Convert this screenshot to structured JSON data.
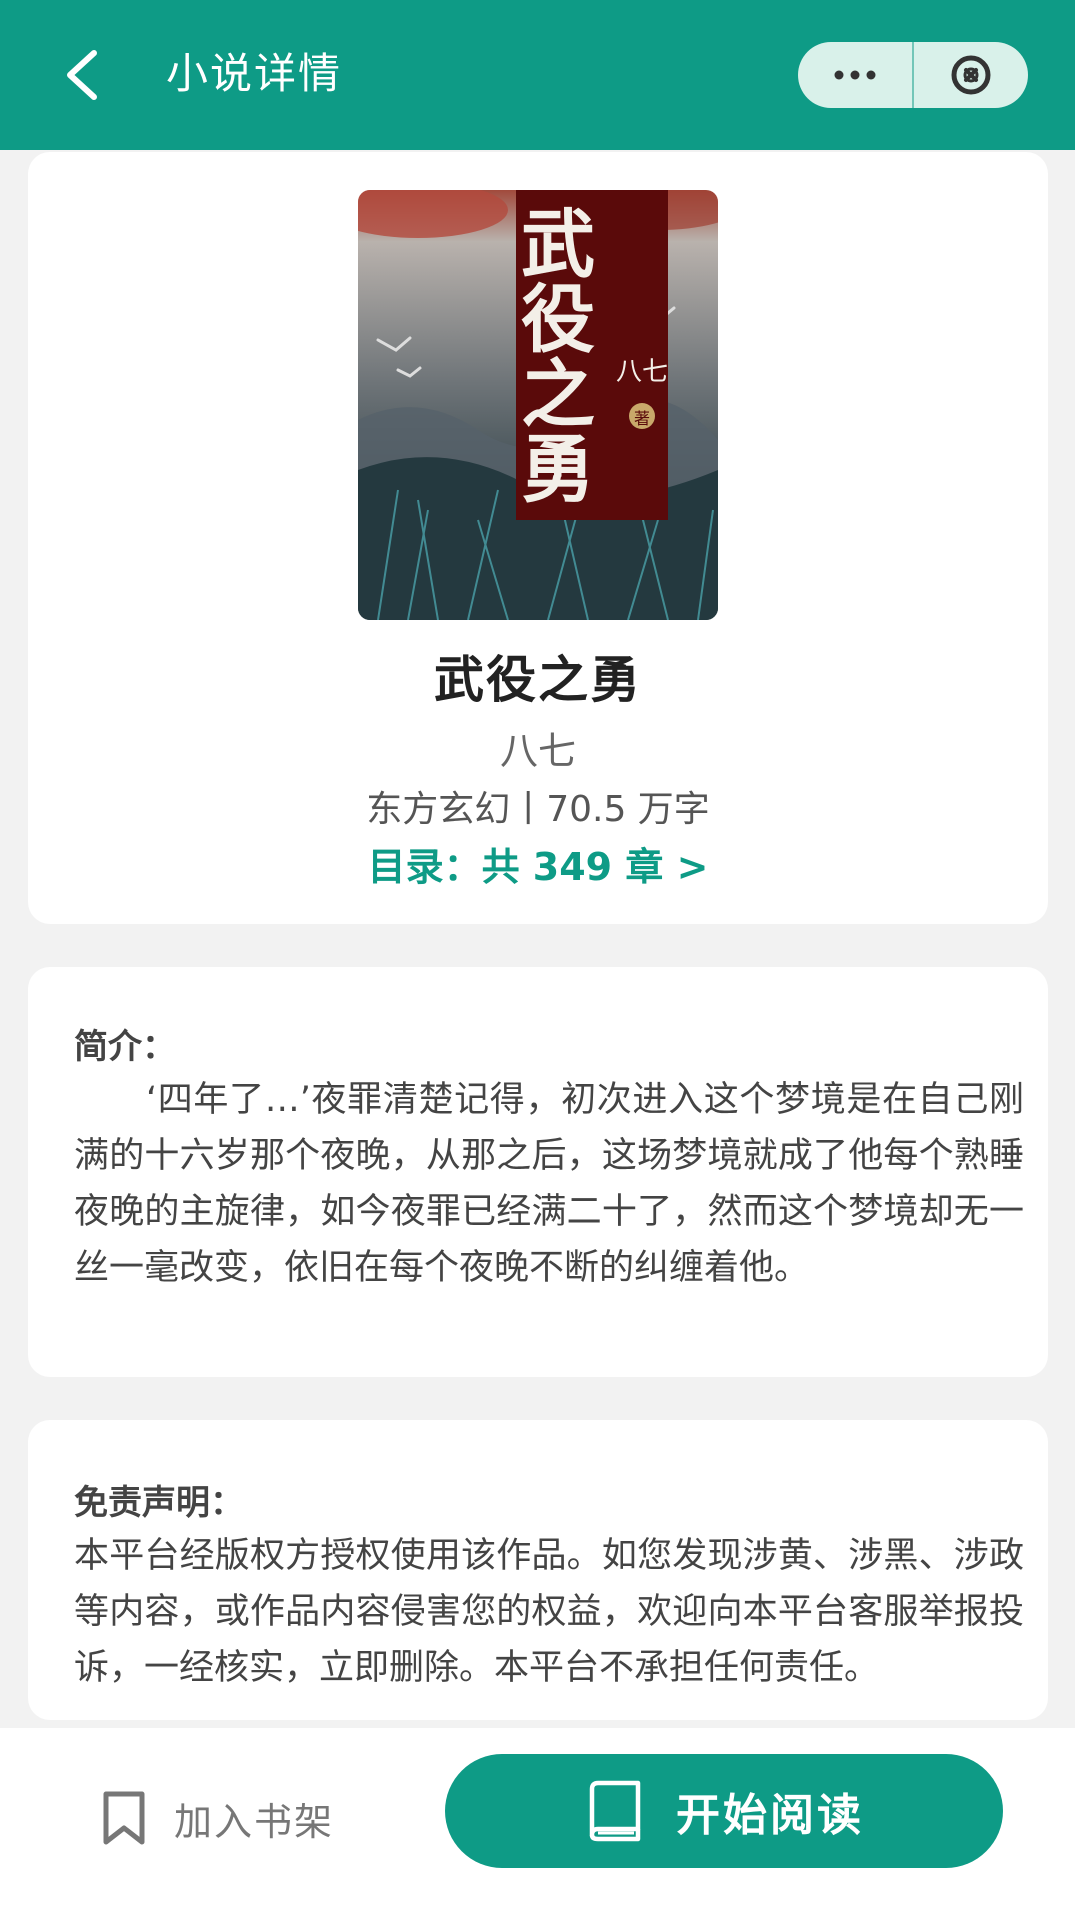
{
  "header": {
    "title": "小说详情",
    "menu_dots": "···"
  },
  "book": {
    "cover_title_chars": [
      "武",
      "役",
      "之",
      "勇"
    ],
    "cover_author": "八七",
    "cover_author_suffix": "著",
    "title": "武役之勇",
    "author": "八七",
    "meta": "东方玄幻丨70.5 万字",
    "toc": "目录：共 349 章 >"
  },
  "intro": {
    "label": "简介：",
    "text": "‘四年了…’夜罪清楚记得，初次进入这个梦境是在自己刚满的十六岁那个夜晚，从那之后，这场梦境就成了他每个熟睡夜晚的主旋律，如今夜罪已经满二十了，然而这个梦境却无一丝一毫改变，依旧在每个夜晚不断的纠缠着他。"
  },
  "disclaimer": {
    "label": "免责声明：",
    "text": "本平台经版权方授权使用该作品。如您发现涉黄、涉黑、涉政等内容，或作品内容侵害您的权益，欢迎向本平台客服举报投诉，一经核实，立即删除。本平台不承担任何责任。"
  },
  "bottom": {
    "shelf_label": "加入书架",
    "read_label": "开始阅读"
  },
  "colors": {
    "accent": "#0e9b86",
    "capsule": "#d9f1ea",
    "cover_band": "#5a0a0a"
  }
}
